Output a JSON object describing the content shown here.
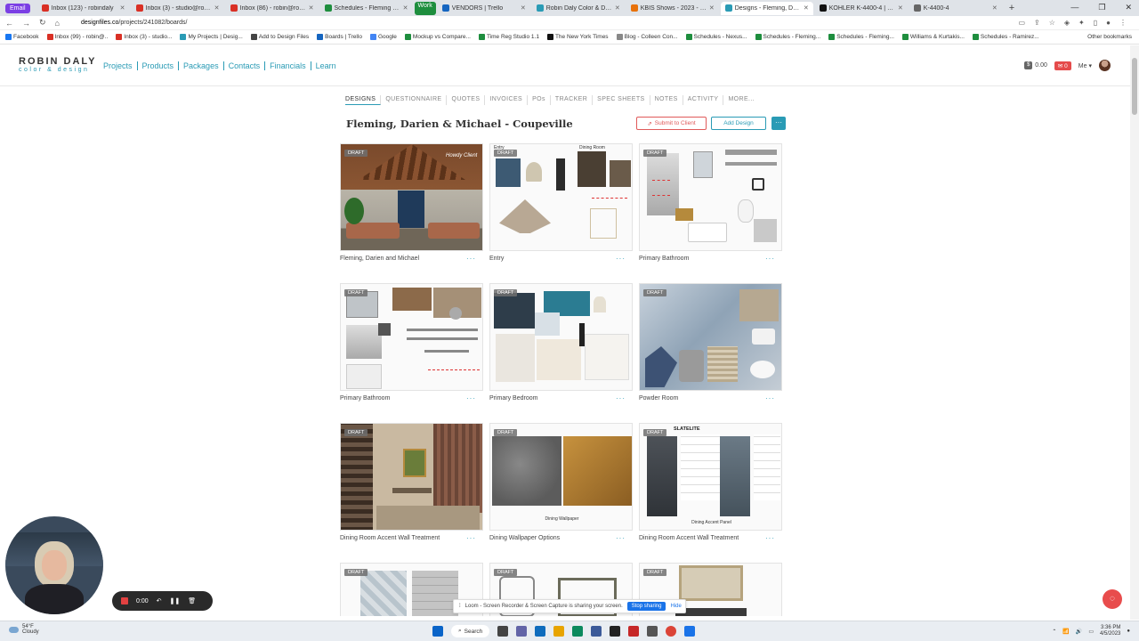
{
  "browser": {
    "profile_chip": "Email",
    "tabs": [
      {
        "label": "Inbox (123) - robindaly",
        "color": "#d93025"
      },
      {
        "label": "Inbox (3) - studio@robin",
        "color": "#d93025"
      },
      {
        "label": "Inbox (86) - robin@robin",
        "color": "#d93025"
      },
      {
        "label": "Schedules - Fleming Upd",
        "color": "#1e8e3e"
      },
      {
        "label": "VENDORS | Trello",
        "color": "#1565c0",
        "group_chip": "Work"
      },
      {
        "label": "Robin Daly Color & Design",
        "color": "#2a9bb5"
      },
      {
        "label": "KBIS Shows - 2023 - Hosts",
        "color": "#e8710a"
      },
      {
        "label": "Designs - Fleming, Darie",
        "color": "#2a9bb5",
        "active": true
      },
      {
        "label": "KOHLER K-4400-4 | Purist",
        "color": "#111111"
      },
      {
        "label": "K-4400-4",
        "color": "#666666"
      }
    ],
    "new_tab": "+",
    "window_controls": [
      "—",
      "❐",
      "✕"
    ],
    "url_host": "designfiles.co",
    "url_path": "/projects/241082/boards/",
    "bookmarks": [
      {
        "label": "Facebook",
        "color": "#1877f2"
      },
      {
        "label": "Inbox (99) - robin@..",
        "color": "#d93025"
      },
      {
        "label": "Inbox (3) - studio...",
        "color": "#d93025"
      },
      {
        "label": "My Projects | Desig...",
        "color": "#2a9bb5"
      },
      {
        "label": "Add to Design Files",
        "color": "#444444"
      },
      {
        "label": "Boards | Trello",
        "color": "#1565c0"
      },
      {
        "label": "Google",
        "color": "#4285f4"
      },
      {
        "label": "Mockup vs Compare...",
        "color": "#1e8e3e"
      },
      {
        "label": "Time Reg Studio 1.1",
        "color": "#1e8e3e"
      },
      {
        "label": "The New York Times",
        "color": "#111111"
      },
      {
        "label": "Blog - Colleen Con...",
        "color": "#888888"
      },
      {
        "label": "Schedules - Nexus...",
        "color": "#1e8e3e"
      },
      {
        "label": "Schedules - Fleming...",
        "color": "#1e8e3e"
      },
      {
        "label": "Schedules - Fleming...",
        "color": "#1e8e3e"
      },
      {
        "label": "Williams & Kurtakis...",
        "color": "#1e8e3e"
      },
      {
        "label": "Schedules - Ramirez...",
        "color": "#1e8e3e"
      }
    ],
    "bookmarks_other": "Other bookmarks"
  },
  "app": {
    "logo_top": "ROBIN DALY",
    "logo_sub": "color & design",
    "nav": [
      "Projects",
      "Products",
      "Packages",
      "Contacts",
      "Financials",
      "Learn"
    ],
    "credits": "0.00",
    "notifications": "0",
    "me_label": "Me"
  },
  "project": {
    "tabs": [
      "DESIGNS",
      "QUESTIONNAIRE",
      "QUOTES",
      "INVOICES",
      "POs",
      "TRACKER",
      "SPEC SHEETS",
      "NOTES",
      "ACTIVITY",
      "MORE..."
    ],
    "title": "Fleming, Darien & Michael - Coupeville",
    "submit_label": "Submit to Client",
    "add_label": "Add Design",
    "more_label": "···"
  },
  "boards": [
    {
      "name": "Fleming, Darien and Michael",
      "status": "DRAFT",
      "art": "house",
      "overlay": "Howdy Client"
    },
    {
      "name": "Entry",
      "status": "DRAFT",
      "art": "entry",
      "overlay": "Dining Room"
    },
    {
      "name": "Primary Bathroom",
      "status": "DRAFT",
      "art": "bath1"
    },
    {
      "name": "Primary Bathroom",
      "status": "DRAFT",
      "art": "bath2"
    },
    {
      "name": "Primary Bedroom",
      "status": "DRAFT",
      "art": "bedroom"
    },
    {
      "name": "Powder Room",
      "status": "DRAFT",
      "art": "powder"
    },
    {
      "name": "Dining Room Accent Wall Treatment",
      "status": "DRAFT",
      "art": "dining"
    },
    {
      "name": "Dining Wallpaper Options",
      "status": "DRAFT",
      "art": "wallpaper",
      "overlay": "Dining Wallpaper"
    },
    {
      "name": "Dining Room Accent Wall Treatment",
      "status": "DRAFT",
      "art": "slate",
      "overlay": "SLATELITE",
      "caption": "Dining Accent Panel"
    },
    {
      "name": "",
      "status": "DRAFT",
      "art": "partial1"
    },
    {
      "name": "",
      "status": "DRAFT",
      "art": "partial2"
    },
    {
      "name": "",
      "status": "DRAFT",
      "art": "partial3"
    }
  ],
  "card_more": "···",
  "recorder": {
    "time": "0:00"
  },
  "screen_share": {
    "text": "Loom - Screen Recorder & Screen Capture is sharing your screen.",
    "stop_label": "Stop sharing",
    "hide_label": "Hide"
  },
  "taskbar": {
    "weather_temp": "54°F",
    "weather_desc": "Cloudy",
    "search_label": "Search",
    "time": "3:36 PM",
    "date": "4/5/2023"
  },
  "colors": {
    "accent": "#2a9bb5",
    "danger": "#e05a5a"
  }
}
